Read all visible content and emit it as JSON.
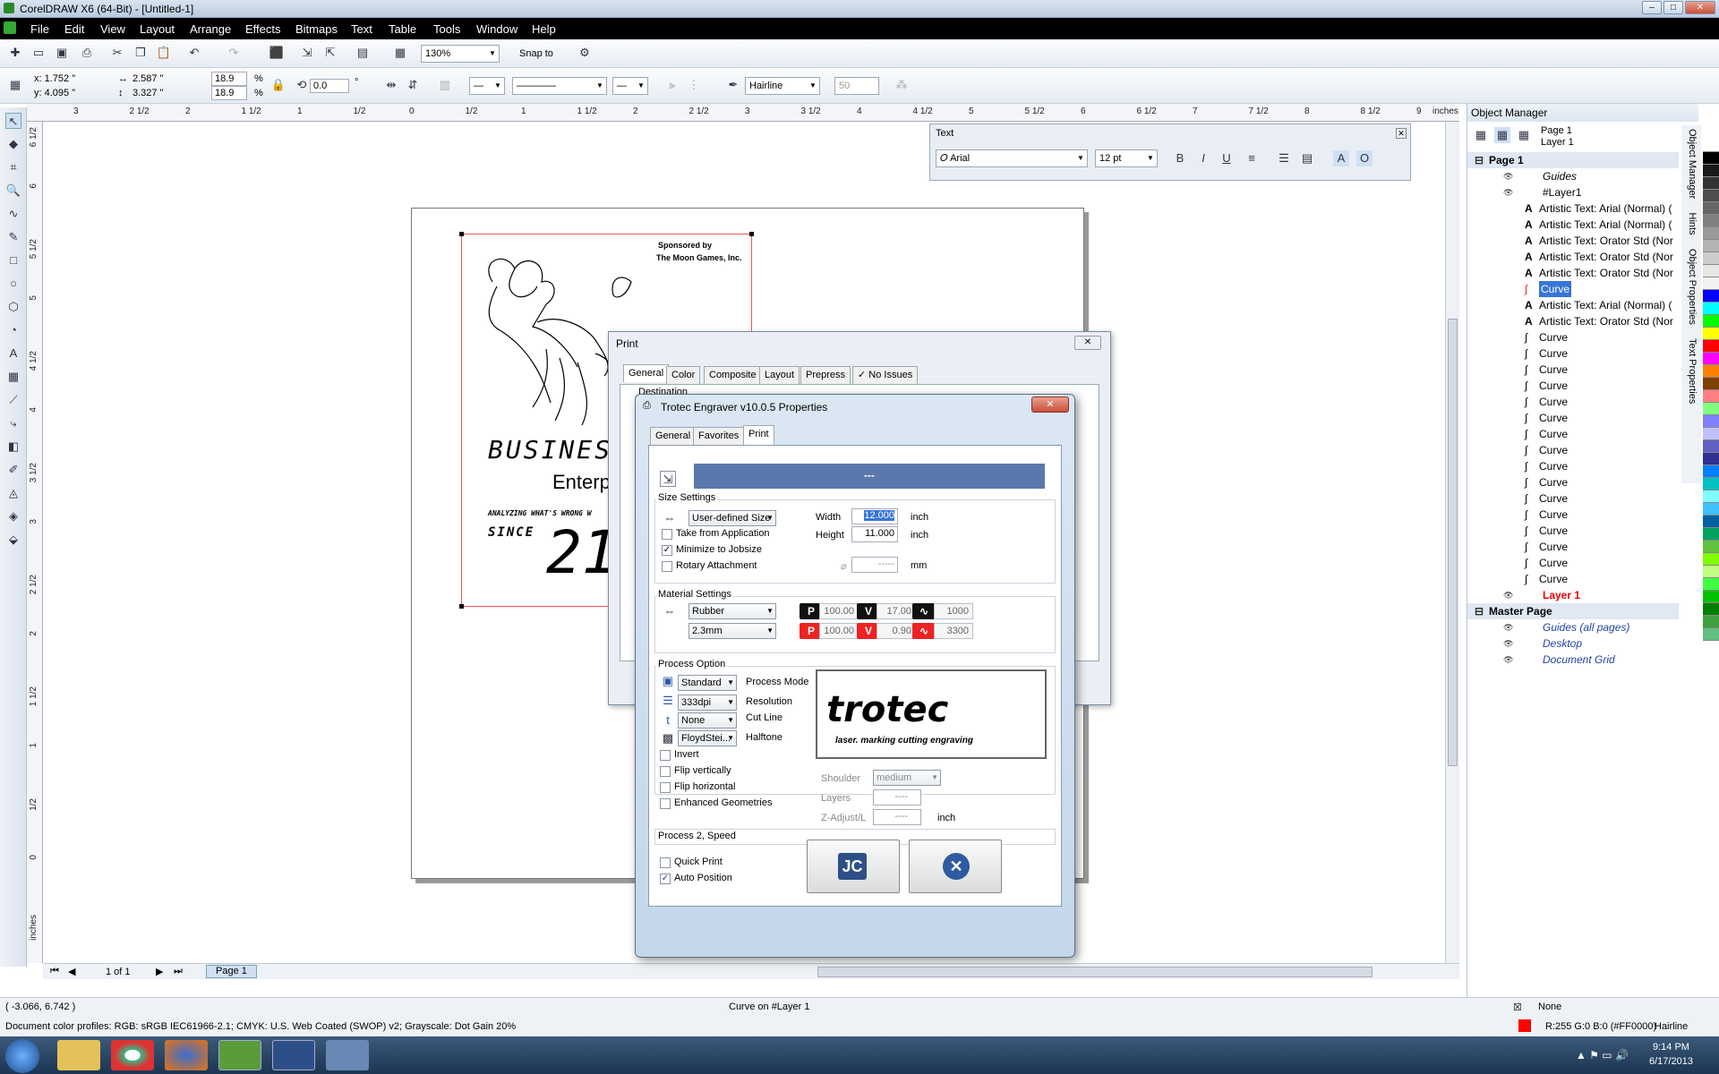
{
  "app": {
    "title": "CorelDRAW X6 (64-Bit) - [Untitled-1]"
  },
  "menu": [
    "File",
    "Edit",
    "View",
    "Layout",
    "Arrange",
    "Effects",
    "Bitmaps",
    "Text",
    "Table",
    "Tools",
    "Window",
    "Help"
  ],
  "toolbar": {
    "zoom": "130%",
    "snap": "Snap to"
  },
  "propbar": {
    "x": "x: 1.752 \"",
    "y": "y: 4.095 \"",
    "w": "2.587 \"",
    "h": "3.327 \"",
    "sx": "18.9",
    "sy": "18.9",
    "pct": "%",
    "angle": "0.0",
    "deg": "°",
    "outline": "Hairline",
    "val50": "50"
  },
  "ruler": {
    "h": [
      "3",
      "2 1/2",
      "2",
      "1 1/2",
      "1",
      "1/2",
      "0",
      "1/2",
      "1",
      "1 1/2",
      "2",
      "2 1/2",
      "3",
      "3 1/2",
      "4",
      "4 1/2",
      "5",
      "5 1/2",
      "6",
      "6 1/2",
      "7",
      "7 1/2",
      "8",
      "8 1/2",
      "9"
    ],
    "unit": "inches",
    "v": [
      "6 1/2",
      "6",
      "5 1/2",
      "5",
      "4 1/2",
      "4",
      "3 1/2",
      "3",
      "2 1/2",
      "2",
      "1 1/2",
      "1",
      "1/2",
      "0"
    ],
    "vunit": "inches"
  },
  "artwork": {
    "sponsor1": "Sponsored by",
    "sponsor2": "The Moon Games, Inc.",
    "business": "BUSINES",
    "enterp": "Enterp",
    "analyzing": "ANALYZING WHAT'S WRONG W",
    "since": "SINCE",
    "year": "21"
  },
  "textbar": {
    "title": "Text",
    "font": "Arial",
    "size": "12 pt"
  },
  "objmgr": {
    "title": "Object Manager",
    "page": "Page 1",
    "layer": "Layer 1",
    "tree": [
      {
        "label": "Page 1",
        "bold": true
      },
      {
        "label": "Guides"
      },
      {
        "label": "#Layer1"
      },
      {
        "label": "Artistic Text: Arial (Normal) ("
      },
      {
        "label": "Artistic Text: Arial (Normal) ("
      },
      {
        "label": "Artistic Text: Orator Std (Nor"
      },
      {
        "label": "Artistic Text: Orator Std (Nor"
      },
      {
        "label": "Artistic Text: Orator Std (Nor"
      },
      {
        "label": "Curve",
        "sel": true
      },
      {
        "label": "Artistic Text: Arial (Normal) ("
      },
      {
        "label": "Artistic Text: Orator Std (Nor"
      },
      {
        "label": "Curve"
      },
      {
        "label": "Curve"
      },
      {
        "label": "Curve"
      },
      {
        "label": "Curve"
      },
      {
        "label": "Curve"
      },
      {
        "label": "Curve"
      },
      {
        "label": "Curve"
      },
      {
        "label": "Curve"
      },
      {
        "label": "Curve"
      },
      {
        "label": "Curve"
      },
      {
        "label": "Curve"
      },
      {
        "label": "Curve"
      },
      {
        "label": "Curve"
      },
      {
        "label": "Curve"
      },
      {
        "label": "Curve"
      },
      {
        "label": "Curve"
      },
      {
        "label": "Layer 1",
        "red": true
      },
      {
        "label": "Master Page",
        "bold": true
      },
      {
        "label": "Guides (all pages)",
        "italic": true
      },
      {
        "label": "Desktop",
        "italic": true
      },
      {
        "label": "Document Grid",
        "italic": true
      }
    ]
  },
  "dockertabs": [
    "Object Manager",
    "Hints",
    "Object Properties",
    "Text Properties"
  ],
  "palette": [
    "#ffffff",
    "#000000",
    "#1a1a1a",
    "#333333",
    "#4d4d4d",
    "#666666",
    "#808080",
    "#999999",
    "#b3b3b3",
    "#cccccc",
    "#e6e6e6",
    "#f2f2f2",
    "#0000ff",
    "#00ffff",
    "#00ff00",
    "#ffff00",
    "#ff0000",
    "#ff00ff",
    "#ff8000",
    "#804000",
    "#ff8080",
    "#80ff80",
    "#8080ff",
    "#c0c0ff",
    "#6060c0",
    "#303090",
    "#0080ff",
    "#00c0c0",
    "#80ffff",
    "#40c0ff",
    "#0060a0",
    "#00a060",
    "#60c040",
    "#80ff00",
    "#c0ff80",
    "#40ff40",
    "#00c000",
    "#008000",
    "#40a040",
    "#60c080"
  ],
  "hscroll": {
    "pageof": "1 of 1",
    "tab": "Page 1"
  },
  "status": {
    "coords": "( -3.066, 6.742 )",
    "center": "Curve on #Layer 1",
    "profile": "Document color profiles: RGB: sRGB IEC61966-2.1; CMYK: U.S. Web Coated (SWOP) v2; Grayscale: Dot Gain 20%",
    "fill": "None",
    "outline": "R:255 G:0 B:0 (#FF0000)",
    "outlinew": "Hairline"
  },
  "print": {
    "title": "Print",
    "tabs": [
      "General",
      "Color",
      "Composite",
      "Layout",
      "Prepress",
      "No Issues"
    ],
    "dest": "Destination"
  },
  "props": {
    "title": "Trotec Engraver v10.0.5 Properties",
    "tabs": [
      "General",
      "Favorites",
      "Print"
    ],
    "banner": "---",
    "size": {
      "group": "Size Settings",
      "mode": "User-defined Size",
      "width_l": "Width",
      "width": "12.000",
      "height_l": "Height",
      "height": "11.000",
      "unit": "inch",
      "take": "Take from Application",
      "minimize": "Minimize to Jobsize",
      "rotary": "Rotary Attachment",
      "rotval": "-----",
      "mm": "mm"
    },
    "material": {
      "group": "Material Settings",
      "mat": "Rubber",
      "thick": "2.3mm",
      "p1": "100.00",
      "v1": "17.00",
      "w1": "1000",
      "p2": "100.00",
      "v2": "0.90",
      "w2": "3300",
      "P": "P",
      "V": "V"
    },
    "process": {
      "group": "Process Option",
      "mode": "Standard",
      "mode_l": "Process Mode",
      "res": "333dpi",
      "res_l": "Resolution",
      "cut": "None",
      "cut_l": "Cut Line",
      "half": "FloydStei...",
      "half_l": "Halftone",
      "invert": "Invert",
      "flipv": "Flip vertically",
      "fliph": "Flip horizontal",
      "enh": "Enhanced Geometries",
      "shoulder_l": "Shoulder",
      "shoulder": "medium",
      "layers_l": "Layers",
      "layers": "----",
      "z_l": "Z-Adjust/L",
      "z": "----",
      "z_unit": "inch"
    },
    "logo": {
      "name": "trotec",
      "tag": "laser. marking cutting engraving"
    },
    "speed": "Process 2, Speed",
    "quick": "Quick Print",
    "auto": "Auto Position"
  },
  "clock": {
    "time": "9:14 PM",
    "date": "6/17/2013"
  }
}
